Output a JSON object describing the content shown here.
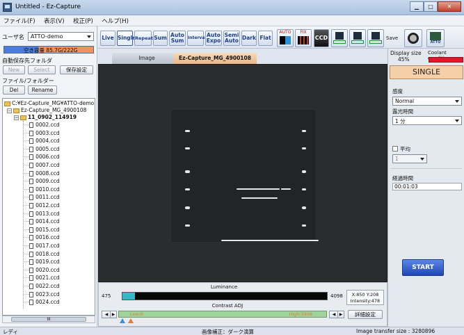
{
  "window": {
    "title": "Untitled - Ez-Capture",
    "min": "▁",
    "max": "□",
    "close": "✕"
  },
  "menu": [
    "ファイル(F)",
    "表示(V)",
    "校正(P)",
    "ヘルプ(H)"
  ],
  "left": {
    "user_label": "ユーザ名",
    "user_value": "ATTO-demo",
    "capacity": "空き容量 85.7G/222G",
    "capacity_fraction": 0.386,
    "autosave_label": "自動保存先フォルダ",
    "btn_new": "New",
    "btn_select": "Select",
    "btn_save_settings": "保存設定",
    "folder_label": "ファイル/フォルダー",
    "btn_del": "Del",
    "btn_rename": "Rename",
    "tree": {
      "root": "C:¥Ez-Capture_MG¥ATTO-demo",
      "child": "Ez-Capture_MG_4900108",
      "sub": "11_0902_114919",
      "files": [
        "0002.ccd",
        "0003.ccd",
        "0004.ccd",
        "0005.ccd",
        "0006.ccd",
        "0007.ccd",
        "0008.ccd",
        "0009.ccd",
        "0010.ccd",
        "0011.ccd",
        "0012.ccd",
        "0013.ccd",
        "0014.ccd",
        "0015.ccd",
        "0016.ccd",
        "0017.ccd",
        "0018.ccd",
        "0019.ccd",
        "0020.ccd",
        "0021.ccd",
        "0022.ccd",
        "0023.ccd",
        "0024.ccd"
      ]
    },
    "scroll_label": "III"
  },
  "toolbar": {
    "buttons": [
      {
        "label": "Live"
      },
      {
        "label": "Single"
      },
      {
        "label": "Repeat"
      },
      {
        "label": "Sum"
      },
      {
        "label": "Auto Sum"
      },
      {
        "label": "Interval"
      },
      {
        "label": "Auto Expo"
      },
      {
        "label": "Semi Auto"
      },
      {
        "label": "Dark"
      },
      {
        "label": "Flat"
      }
    ],
    "auto": "AUTO",
    "fix": "FIX",
    "ccd": "CCD",
    "save": "Save",
    "atto": "ATTO"
  },
  "tabs": {
    "image": "Image",
    "file": "Ez-Capture_MG_4900108"
  },
  "luminance": {
    "title": "Luminance",
    "min": "475",
    "max": "4098",
    "fill_fraction": 0.06,
    "coord": "X:850 Y:208",
    "intensity": "Intensity:478",
    "contrast_title": "Contrast ADJ",
    "low": "Low:0",
    "high": "High:3998",
    "detail_btn": "詳細設定"
  },
  "right": {
    "display_size_label": "Display size",
    "display_size_value": "45%",
    "coolant_label": "Coolant condition",
    "coolant_color": "#e0182d",
    "mode": "SINGLE",
    "sensitivity_label": "感度",
    "sensitivity_value": "Normal",
    "exposure_label": "露光時間",
    "exposure_value": "1 分",
    "average_label": "平均",
    "average_value": "1",
    "elapsed_label": "経過時間",
    "elapsed_value": "00:01:03",
    "start": "START"
  },
  "status": {
    "left": "レディ",
    "center": "画像補正：ダーク演算",
    "right": "Image transfer size : 3280896"
  }
}
